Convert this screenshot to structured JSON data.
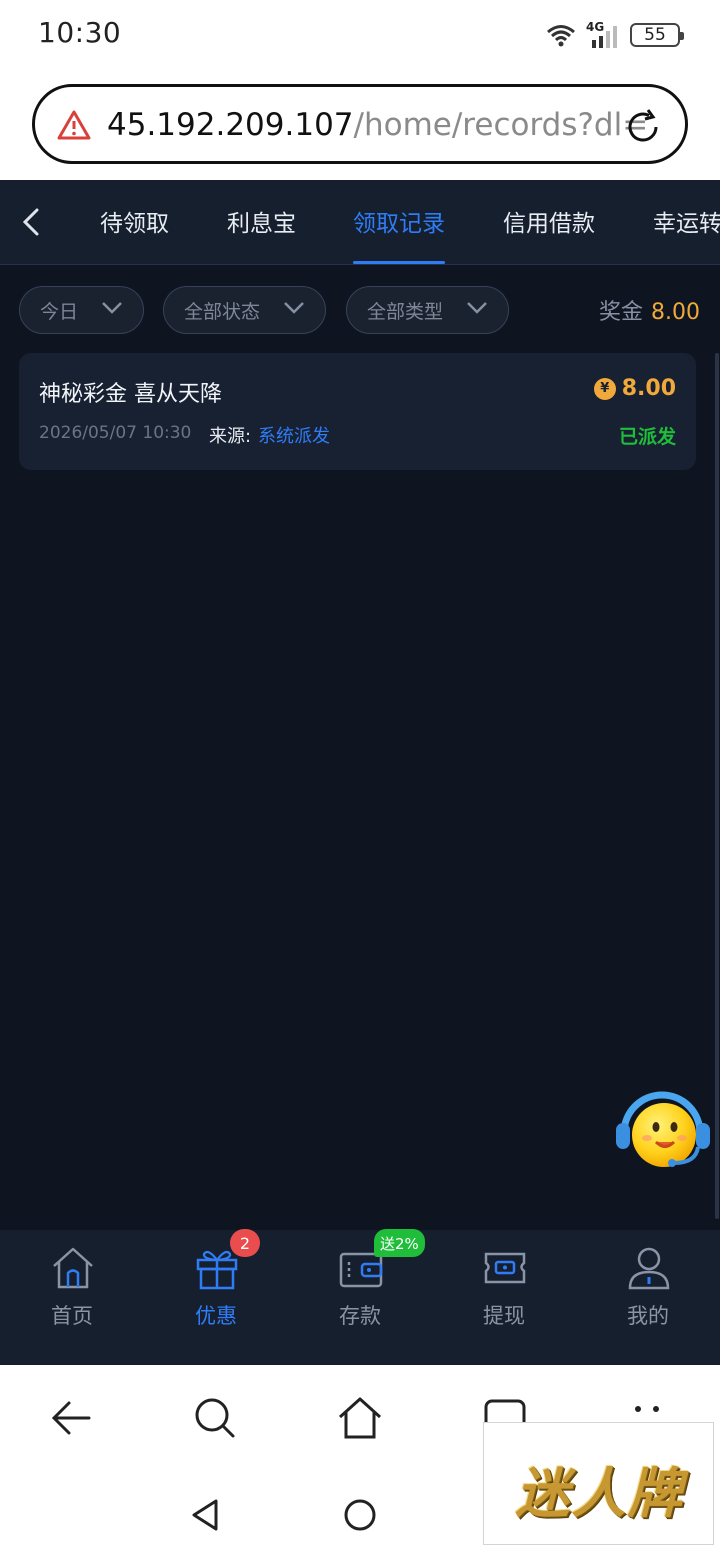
{
  "status_bar": {
    "time": "10:30",
    "network": "4G",
    "battery": "55"
  },
  "url_bar": {
    "host": "45.192.209.107",
    "path": "/home/records?dl="
  },
  "tabs": [
    {
      "label": "待领取",
      "active": false
    },
    {
      "label": "利息宝",
      "active": false
    },
    {
      "label": "领取记录",
      "active": true
    },
    {
      "label": "信用借款",
      "active": false
    },
    {
      "label": "幸运转",
      "active": false
    }
  ],
  "filters": {
    "date": "今日",
    "status": "全部状态",
    "type": "全部类型"
  },
  "bonus_total": {
    "label": "奖金",
    "value": "8.00"
  },
  "record": {
    "title": "神秘彩金 喜从天降",
    "currency_symbol": "¥",
    "amount": "8.00",
    "date": "2026/05/07 10:30",
    "source_label": "来源:",
    "source_value": "系统派发",
    "status": "已派发"
  },
  "bottom_nav": [
    {
      "label": "首页",
      "icon": "home-icon",
      "active": false
    },
    {
      "label": "优惠",
      "icon": "gift-icon",
      "active": true,
      "badge": "2"
    },
    {
      "label": "存款",
      "icon": "wallet-icon",
      "active": false,
      "badge": "送2%"
    },
    {
      "label": "提现",
      "icon": "ticket-icon",
      "active": false
    },
    {
      "label": "我的",
      "icon": "user-icon",
      "active": false
    }
  ],
  "watermark": "迷人牌",
  "colors": {
    "accent": "#2f7cf6",
    "gold": "#f1a93b",
    "success": "#1fbd3a",
    "background": "#0f1520"
  }
}
